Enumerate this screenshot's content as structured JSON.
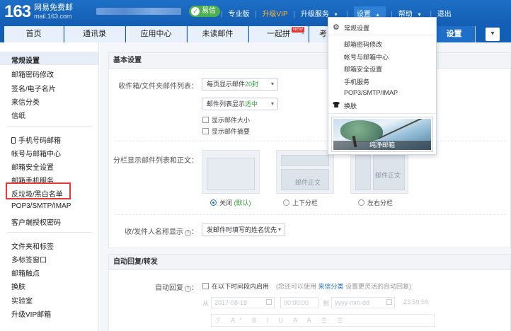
{
  "topbar": {
    "logo_text": "163",
    "logo_line1": "网易免费邮",
    "logo_line2": "mail.163.com",
    "yixin_label": "易信",
    "links": {
      "pro": "专业版",
      "upgrade_vip": "升级VIP",
      "upgrade_service": "升级服务",
      "settings": "设置",
      "help": "帮助",
      "logout": "退出"
    }
  },
  "tabs": {
    "home": "首页",
    "contacts": "通讯录",
    "apps": "应用中心",
    "unread": "未读邮件",
    "pinduo": "一起拼",
    "pinduo_badge": "NEW",
    "partial": "考",
    "settings": "设置",
    "close_symbol": "×"
  },
  "sidebar": {
    "group1": [
      "常规设置",
      "邮箱密码修改",
      "签名/电子名片",
      "来信分类",
      "信纸"
    ],
    "group2": [
      "手机号码邮箱",
      "帐号与邮箱中心",
      "邮箱安全设置",
      "邮箱手机服务",
      "反垃圾/黑白名单",
      "POP3/SMTP/IMAP",
      "客户端授权密码"
    ],
    "group3": [
      "文件夹和标签",
      "多标签窗口",
      "邮箱触点",
      "换肤",
      "实验室",
      "升级VIP邮箱"
    ]
  },
  "basic": {
    "title": "基本设置",
    "inbox_label": "收件箱/文件夹邮件列表：",
    "per_page_prefix": "每页显示邮件",
    "per_page_value": "20封",
    "density_prefix": "邮件列表显示",
    "density_value": "适中",
    "show_size": "显示邮件大小",
    "show_summary": "显示邮件摘要",
    "split_label": "分栏显示邮件列表和正文：",
    "card_body_text": "邮件正文",
    "opt_off": "关闭",
    "opt_default": "(默认)",
    "opt_updown": "上下分栏",
    "opt_leftright": "左右分栏",
    "name_label": "收/发件人名称显示",
    "name_value": "发邮件时填写的姓名优先"
  },
  "autoreply": {
    "title": "自动回复/转发",
    "label": "自动回复",
    "enable_text": "在以下时间段内启用",
    "hint_prefix": "(您还可以使用",
    "hint_link": "来信分类",
    "hint_suffix": "设置更灵活的自动回复)",
    "from": "从",
    "start_date": "2017-08-18",
    "start_time": "00:00:00",
    "to": "到",
    "end_date": "yyyy-mm-dd",
    "end_time": "23:59:59",
    "toolbar_glyphs": "ℱ A° B I U A A ☰ ☰"
  },
  "dropdown": {
    "items": [
      "常规设置",
      "邮箱密码修改",
      "帐号与邮箱中心",
      "邮箱安全设置",
      "手机服务",
      "POP3/SMTP/IMAP",
      "换肤"
    ],
    "theme_caption": "纯净邮箱"
  }
}
